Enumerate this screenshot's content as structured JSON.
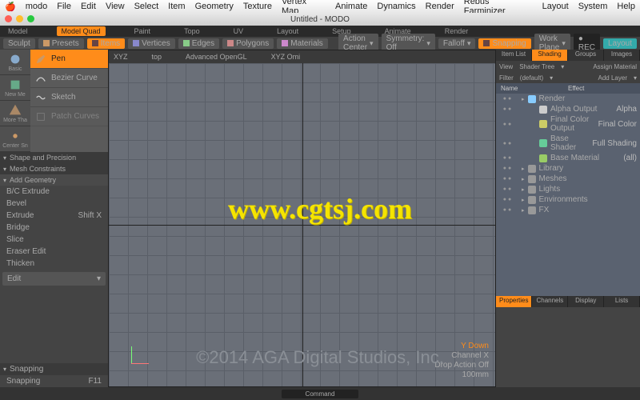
{
  "mac_menu": [
    "modo",
    "File",
    "Edit",
    "View",
    "Select",
    "Item",
    "Geometry",
    "Texture",
    "Vertex Map",
    "Animate",
    "Dynamics",
    "Render",
    "Rebus Farminizer",
    "Layout",
    "System",
    "Help"
  ],
  "window_title": "Untitled - MODO",
  "top_tabs": [
    "Model",
    "Model Quad",
    "Paint",
    "Topo",
    "UV",
    "Layout",
    "Setup",
    "Animate",
    "Render"
  ],
  "top_tab_active": 1,
  "toolbar": {
    "sculpt": "Sculpt",
    "presets": "Presets",
    "items": "Items",
    "vertices": "Vertices",
    "edges": "Edges",
    "polygons": "Polygons",
    "materials": "Materials",
    "action_center": "Action Center",
    "symmetry": "Symmetry: Off",
    "falloff": "Falloff",
    "snapping": "Snapping",
    "workplane": "Work Plane",
    "rec": "● REC",
    "layout": "Layout"
  },
  "left": {
    "icon_labels": [
      "Basic",
      "New Me",
      "More Tha",
      "Center Sn"
    ],
    "tools": [
      "Pen",
      "Bezier Curve",
      "Sketch",
      "Patch Curves"
    ],
    "tool_selected": 0,
    "sections": [
      {
        "name": "Shape and Precision",
        "open": true
      },
      {
        "name": "Mesh Constraints",
        "open": true
      },
      {
        "name": "Add Geometry",
        "rows": [
          {
            "l": "B/C Extrude",
            "r": ""
          },
          {
            "l": "Bevel",
            "r": ""
          },
          {
            "l": "Extrude",
            "r": "Shift X"
          },
          {
            "l": "Bridge",
            "r": ""
          },
          {
            "l": "Slice",
            "r": ""
          },
          {
            "l": "Eraser Edit",
            "r": ""
          },
          {
            "l": "Thicken",
            "r": ""
          }
        ]
      },
      {
        "name": "Edit",
        "open": false
      }
    ],
    "snapping_label": "Snapping",
    "snapping_val": "F11"
  },
  "viewport": {
    "tabs": [
      "XYZ",
      "top",
      "Advanced OpenGL",
      "XYZ Omi"
    ],
    "info": {
      "view": "Y Down",
      "channel": "Channel X",
      "drop": "Drop Action Off",
      "size": "100mm"
    }
  },
  "right": {
    "top_tabs": [
      "Item List",
      "Shading",
      "Groups",
      "Images"
    ],
    "top_active": 1,
    "sub": {
      "view": "View",
      "shader": "Shader Tree",
      "assign": "Assign Material",
      "filter": "Filter",
      "default": "(default)",
      "add": "Add Layer"
    },
    "tree_hdr": [
      "Name",
      "Effect"
    ],
    "tree": [
      {
        "indent": 0,
        "icon": "render",
        "ico_color": "#8cf",
        "name": "Render",
        "effect": ""
      },
      {
        "indent": 1,
        "icon": "alpha",
        "ico_color": "#ccc",
        "name": "Alpha Output",
        "effect": "Alpha"
      },
      {
        "indent": 1,
        "icon": "color",
        "ico_color": "#cc6",
        "name": "Final Color Output",
        "effect": "Final Color"
      },
      {
        "indent": 1,
        "icon": "shader",
        "ico_color": "#6c9",
        "name": "Base Shader",
        "effect": "Full Shading"
      },
      {
        "indent": 1,
        "icon": "mat",
        "ico_color": "#9c6",
        "name": "Base Material",
        "effect": "(all)"
      },
      {
        "indent": 0,
        "icon": "lib",
        "ico_color": "#999",
        "name": "Library",
        "effect": ""
      },
      {
        "indent": 0,
        "icon": "mesh",
        "ico_color": "#999",
        "name": "Meshes",
        "effect": ""
      },
      {
        "indent": 0,
        "icon": "light",
        "ico_color": "#999",
        "name": "Lights",
        "effect": ""
      },
      {
        "indent": 0,
        "icon": "env",
        "ico_color": "#999",
        "name": "Environments",
        "effect": ""
      },
      {
        "indent": 0,
        "icon": "fx",
        "ico_color": "#999",
        "name": "FX",
        "effect": ""
      }
    ],
    "prop_tabs": [
      "Properties",
      "Channels",
      "Display",
      "Lists"
    ]
  },
  "status": {
    "command": "Command"
  },
  "watermark_url": "www.cgtsj.com",
  "watermark_copy": "©2014 AGA Digital Studios, Inc."
}
